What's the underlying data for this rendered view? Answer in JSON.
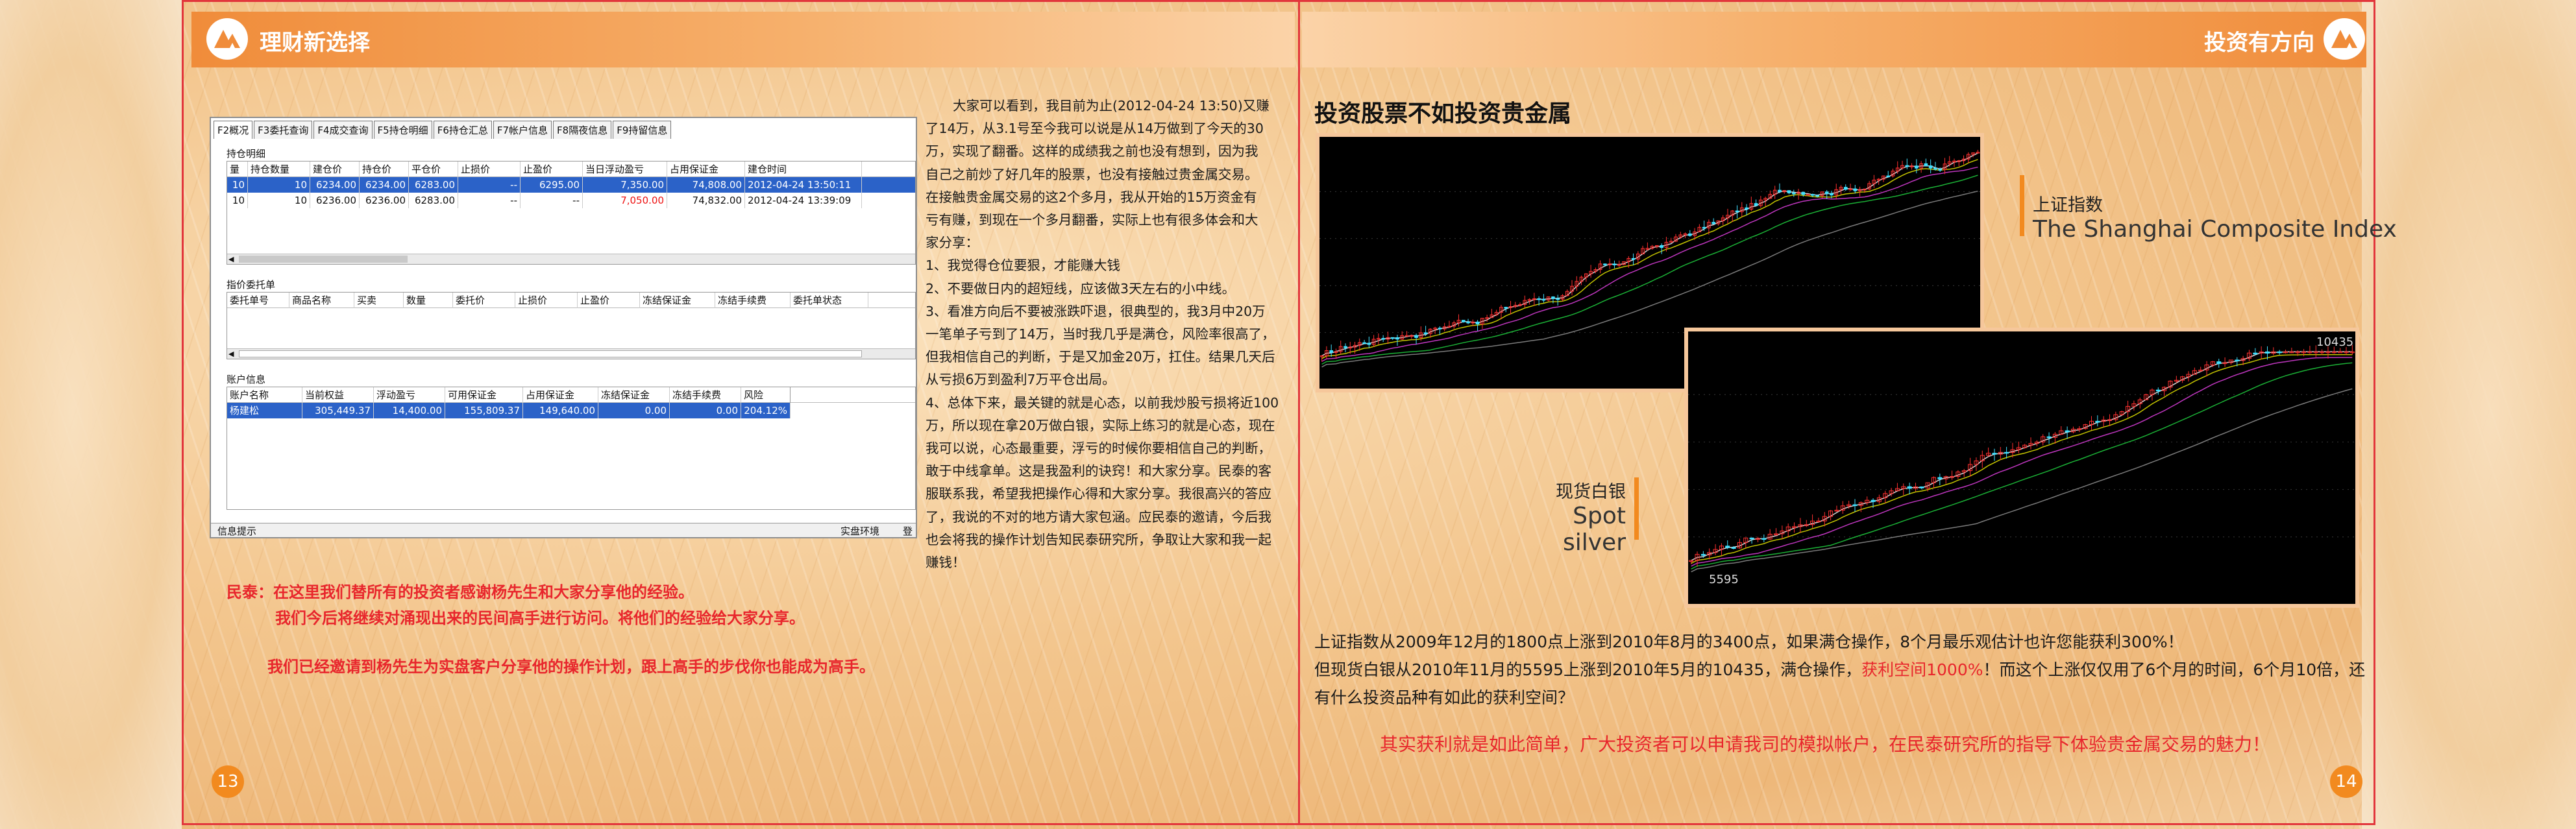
{
  "header": {
    "left_title": "理财新选择",
    "right_title": "投资有方向"
  },
  "trade_window": {
    "tabs": [
      "F2概况",
      "F3委托查询",
      "F4成交查询",
      "F5持仓明细",
      "F6持仓汇总",
      "F7帐户信息",
      "F8隔夜信息",
      "F9持留信息"
    ],
    "positions": {
      "title": "持仓明细",
      "columns": [
        "量",
        "持仓数量",
        "建仓价",
        "持仓价",
        "平仓价",
        "止损价",
        "止盈价",
        "当日浮动盈亏",
        "占用保证金",
        "建仓时间"
      ],
      "rows": [
        [
          "10",
          "10",
          "6234.00",
          "6234.00",
          "6283.00",
          "--",
          "6295.00",
          "7,350.00",
          "74,808.00",
          "2012-04-24 13:50:11"
        ],
        [
          "10",
          "10",
          "6236.00",
          "6236.00",
          "6283.00",
          "--",
          "--",
          "7,050.00",
          "74,832.00",
          "2012-04-24 13:39:09"
        ]
      ]
    },
    "orders": {
      "title": "指价委托单",
      "columns": [
        "委托单号",
        "商品名称",
        "买卖",
        "数量",
        "委托价",
        "止损价",
        "止盈价",
        "冻结保证金",
        "冻结手续费",
        "委托单状态"
      ]
    },
    "account": {
      "title": "账户信息",
      "columns": [
        "账户名称",
        "当前权益",
        "浮动盈亏",
        "可用保证金",
        "占用保证金",
        "冻结保证金",
        "冻结手续费",
        "风险"
      ],
      "rows": [
        [
          "杨建松",
          "305,449.37",
          "14,400.00",
          "155,809.37",
          "149,640.00",
          "0.00",
          "0.00",
          "204.12%"
        ]
      ]
    },
    "status_left": "信息提示",
    "status_right": "实盘环境",
    "status_cut": "登"
  },
  "red_notes": {
    "line1": "民泰：在这里我们替所有的投资者感谢杨先生和大家分享他的经验。",
    "line2": "我们今后将继续对涌现出来的民间高手进行访问。将他们的经验给大家分享。",
    "line3": "我们已经邀请到杨先生为实盘客户分享他的操作计划，跟上高手的步伐你也能成为高手。"
  },
  "body_lines": [
    "大家可以看到，我目前为止(2012-04-24 13:50)又赚",
    "了14万，从3.1号至今我可以说是从14万做到了今天的30",
    "万，实现了翻番。这样的成绩我之前也没有想到，因为我",
    "自己之前炒了好几年的股票，也没有接触过贵金属交易。",
    "在接触贵金属交易的这2个多月，我从开始的15万资金有",
    "亏有赚，到现在一个多月翻番，实际上也有很多体会和大",
    "家分享：",
    "1、我觉得仓位要狠，才能赚大钱",
    "2、不要做日内的超短线，应该做3天左右的小中线。",
    "3、看准方向后不要被涨跌吓退，很典型的，我3月中20万",
    "一笔单子亏到了14万，当时我几乎是满仓，风险率很高了，",
    "但我相信自己的判断，于是又加金20万，扛住。结果几天后",
    "从亏损6万到盈利7万平仓出局。",
    "4、总体下来，最关键的就是心态，以前我炒股亏损将近100",
    "万，所以现在拿20万做白银，实际上练习的就是心态，现在",
    "我可以说，心态最重要，浮亏的时候你要相信自己的判断，",
    "敢于中线拿单。这是我盈利的诀窍！和大家分享。民泰的客",
    "服联系我，希望我把操作心得和大家分享。我很高兴的答应",
    "了，我说的不对的地方请大家包涵。应民泰的邀请，今后我",
    "也会将我的操作计划告知民泰研究所，争取让大家和我一起",
    "赚钱！"
  ],
  "right_page": {
    "title": "投资股票不如投资贵金属",
    "chart1": {
      "label_cn": "上证指数",
      "label_en": "The Shanghai Composite Index"
    },
    "chart2": {
      "label_cn": "现货白银",
      "label_en": "Spot silver",
      "low_label": "5595",
      "high_label": "10435"
    },
    "para1": "上证指数从2009年12月的1800点上涨到2010年8月的3400点，如果满仓操作，8个月最乐观估计也许您能获利300%！",
    "para2_a": "但现货白银从2010年11月的5595上涨到2010年5月的10435，满仓操作，",
    "para2_hl": "获利空间1000%",
    "para2_b": "！而这个上涨仅仅用了6个月的时间，6个月10倍，还",
    "para3": "有什么投资品种有如此的获利空间？",
    "closing": "其实获利就是如此简单，广大投资者可以申请我司的模拟帐户，在民泰研究所的指导下体验贵金属交易的魅力！"
  },
  "page_numbers": {
    "left": "13",
    "right": "14"
  },
  "colors": {
    "accent": "#f28a1f",
    "highlight_red": "#e8262c",
    "trim_red": "#e2363c"
  }
}
